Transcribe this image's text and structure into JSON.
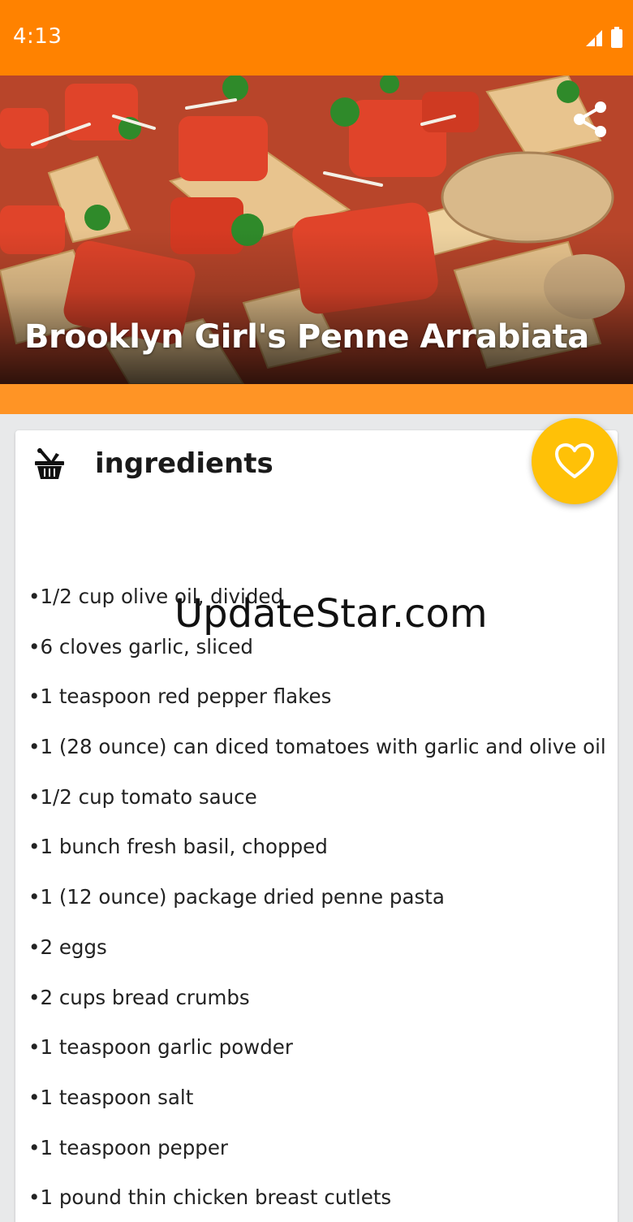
{
  "status_bar": {
    "time": "4:13",
    "icons": [
      "signal-icon",
      "battery-icon"
    ],
    "color": "#ff8200"
  },
  "hero": {
    "title": "Brooklyn Girl's Penne Arrabiata",
    "share_icon": "share-icon"
  },
  "section": {
    "title": "ingredients",
    "icon": "basket-icon"
  },
  "ingredients": [
    "•1/2 cup olive oil, divided",
    "•6 cloves garlic, sliced",
    "•1 teaspoon red pepper flakes",
    "•1 (28 ounce) can diced tomatoes with garlic and olive oil",
    "•1/2 cup tomato sauce",
    "•1 bunch fresh basil, chopped",
    "•1 (12 ounce) package dried penne pasta",
    "•2 eggs",
    "•2 cups bread crumbs",
    "•1 teaspoon garlic powder",
    "•1 teaspoon salt",
    "•1 teaspoon pepper",
    "•1 pound thin chicken breast cutlets"
  ],
  "favorite": {
    "icon": "heart-icon",
    "color": "#ffc107"
  },
  "watermark": "UpdateStar.com",
  "colors": {
    "accent": "#ff8200",
    "strip": "#ff9425",
    "background": "#e8e9ea"
  }
}
